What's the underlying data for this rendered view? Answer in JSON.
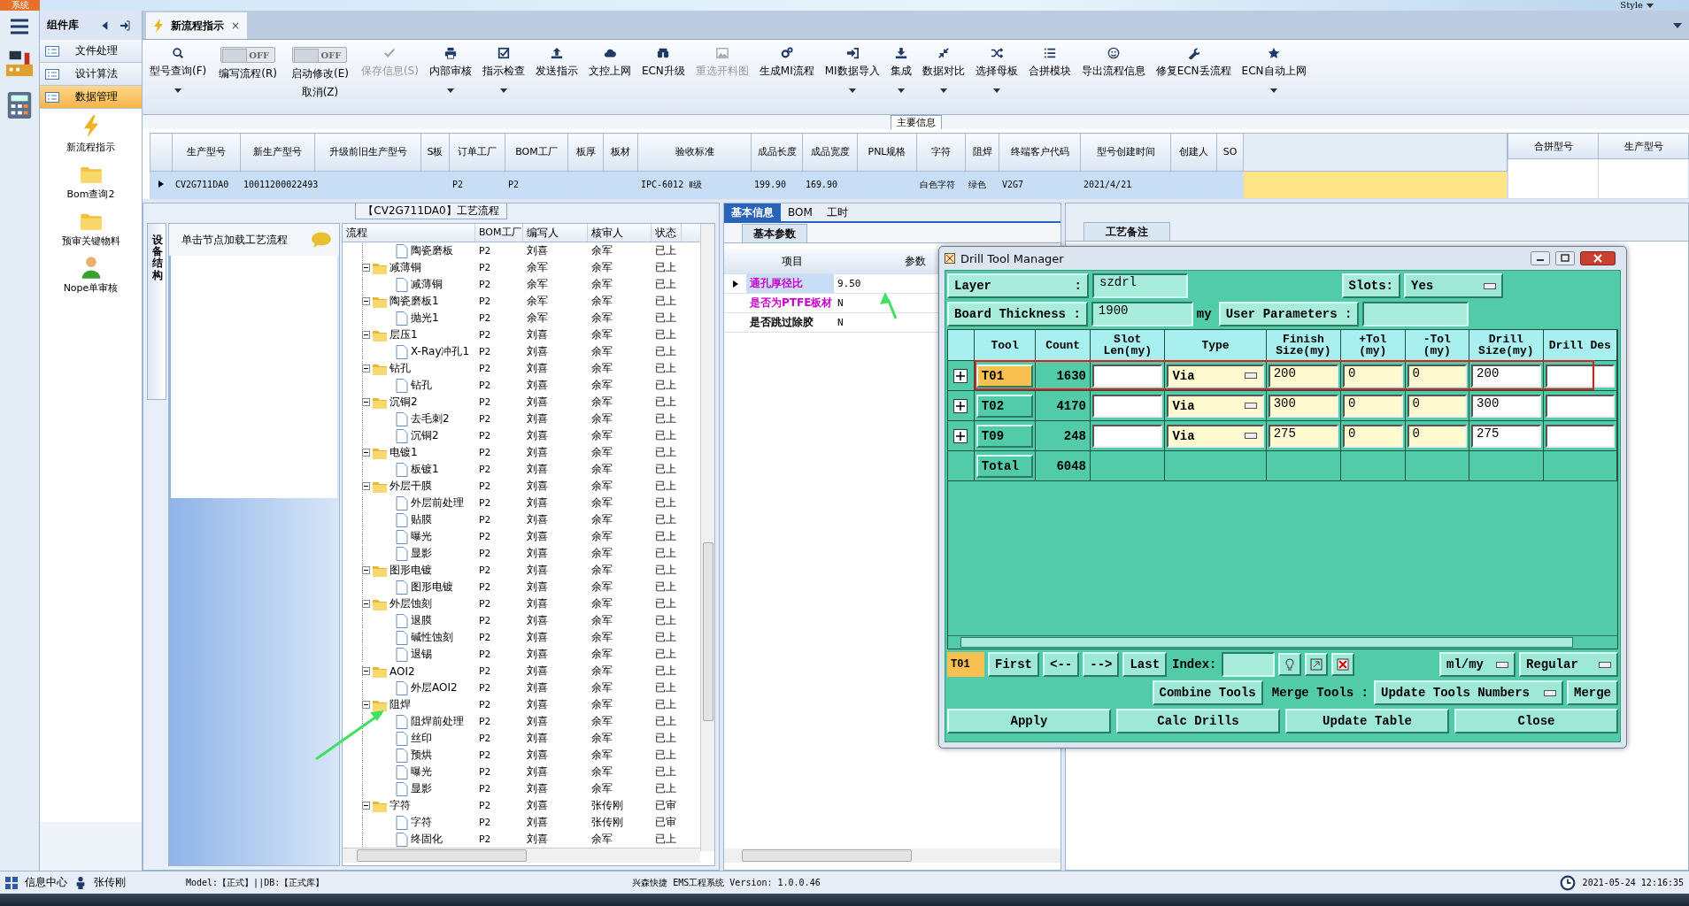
{
  "app_tab": "系统",
  "style_menu": "Style",
  "sidebar": {
    "title": "组件库",
    "nav": [
      {
        "label": "文件处理",
        "selected": false
      },
      {
        "label": "设计算法",
        "selected": false
      },
      {
        "label": "数据管理",
        "selected": true
      }
    ],
    "tiles": [
      "新流程指示",
      "Bom查询2",
      "预审关键物料",
      "Nope单审核"
    ]
  },
  "doc_tab": {
    "label": "新流程指示",
    "close": "×"
  },
  "toolbar": [
    {
      "kind": "button",
      "label": "型号查询(F)",
      "dropdown": true,
      "disabled": false
    },
    {
      "kind": "toggle",
      "label": "编写流程(R)",
      "switch": "OFF",
      "on": false
    },
    {
      "kind": "toggle",
      "label": "启动修改(E)",
      "label2": "取消(Z)",
      "switch": "OFF",
      "on": false
    },
    {
      "kind": "button",
      "label": "保存信息(S)",
      "dropdown": false,
      "disabled": true
    },
    {
      "kind": "button",
      "label": "内部审核",
      "dropdown": true,
      "disabled": false
    },
    {
      "kind": "button",
      "label": "指示检查",
      "dropdown": true,
      "disabled": false
    },
    {
      "kind": "button",
      "label": "发送指示",
      "dropdown": false,
      "disabled": false
    },
    {
      "kind": "button",
      "label": "文控上网",
      "dropdown": false,
      "disabled": false
    },
    {
      "kind": "button",
      "label": "ECN升级",
      "dropdown": false,
      "disabled": false
    },
    {
      "kind": "button",
      "label": "重选开料图",
      "dropdown": false,
      "disabled": true
    },
    {
      "kind": "button",
      "label": "生成MI流程",
      "dropdown": false,
      "disabled": false
    },
    {
      "kind": "button",
      "label": "MI数据导入",
      "dropdown": true,
      "disabled": false
    },
    {
      "kind": "button",
      "label": "集成",
      "dropdown": true,
      "disabled": false
    },
    {
      "kind": "button",
      "label": "数据对比",
      "dropdown": true,
      "disabled": false
    },
    {
      "kind": "button",
      "label": "选择母板",
      "dropdown": true,
      "disabled": false
    },
    {
      "kind": "button",
      "label": "合拼模块",
      "dropdown": false,
      "disabled": false
    },
    {
      "kind": "button",
      "label": "导出流程信息",
      "dropdown": false,
      "disabled": false
    },
    {
      "kind": "button",
      "label": "修复ECN丢流程",
      "dropdown": false,
      "disabled": false
    },
    {
      "kind": "button",
      "label": "ECN自动上网",
      "dropdown": true,
      "disabled": false
    }
  ],
  "main_info": {
    "title": "主要信息",
    "columns": [
      "生产型号",
      "新生产型号",
      "升级前旧生产型号",
      "S板",
      "订单工厂",
      "BOM工厂",
      "板厚",
      "板材",
      "验收标准",
      "成品长度",
      "成品宽度",
      "PNL规格",
      "字符",
      "阻焊",
      "终端客户代码",
      "型号创建时间",
      "创建人",
      "SO"
    ],
    "rows": [
      {
        "selected": true,
        "cells": [
          "CV2G711DA0",
          "10011200022493",
          null,
          null,
          "P2",
          "P2",
          null,
          null,
          "IPC-6012 Ⅱ级",
          "199.90",
          "169.90",
          null,
          "白色字符",
          "绿色",
          "V2G7",
          "2021/4/21",
          null,
          null
        ]
      }
    ]
  },
  "merge_grid": {
    "columns": [
      "合拼型号",
      "生产型号"
    ]
  },
  "process_panel": {
    "title": "【CV2G711DA0】工艺流程",
    "side_tab": "设备结构",
    "hint": "单击节点加载工艺流程",
    "columns": [
      "流程",
      "BOM工厂",
      "编写人",
      "核审人",
      "状态"
    ],
    "tree": [
      {
        "kind": "file",
        "label": "陶瓷磨板",
        "bom": "P2",
        "writer": "刘喜",
        "reviewer": "余军",
        "status": "已上"
      },
      {
        "kind": "folder",
        "label": "减薄铜",
        "bom": "P2",
        "writer": "余军",
        "reviewer": "余军",
        "status": "已上",
        "expanded": true,
        "children": [
          {
            "kind": "file",
            "label": "减薄铜",
            "bom": "P2",
            "writer": "余军",
            "reviewer": "余军",
            "status": "已上"
          }
        ]
      },
      {
        "kind": "folder",
        "label": "陶瓷磨板1",
        "bom": "P2",
        "writer": "余军",
        "reviewer": "余军",
        "status": "已上",
        "expanded": true,
        "children": [
          {
            "kind": "file",
            "label": "抛光1",
            "bom": "P2",
            "writer": "余军",
            "reviewer": "余军",
            "status": "已上"
          }
        ]
      },
      {
        "kind": "folder",
        "label": "层压1",
        "bom": "P2",
        "writer": "刘喜",
        "reviewer": "余军",
        "status": "已上",
        "expanded": true,
        "children": [
          {
            "kind": "file",
            "label": "X-Ray冲孔1",
            "bom": "P2",
            "writer": "刘喜",
            "reviewer": "余军",
            "status": "已上"
          }
        ]
      },
      {
        "kind": "folder",
        "label": "钻孔",
        "bom": "P2",
        "writer": "刘喜",
        "reviewer": "余军",
        "status": "已上",
        "expanded": true,
        "children": [
          {
            "kind": "file",
            "label": "钻孔",
            "bom": "P2",
            "writer": "刘喜",
            "reviewer": "余军",
            "status": "已上"
          }
        ]
      },
      {
        "kind": "folder",
        "label": "沉铜2",
        "bom": "P2",
        "writer": "刘喜",
        "reviewer": "余军",
        "status": "已上",
        "expanded": true,
        "children": [
          {
            "kind": "file",
            "label": "去毛刺2",
            "bom": "P2",
            "writer": "刘喜",
            "reviewer": "余军",
            "status": "已上"
          },
          {
            "kind": "file",
            "label": "沉铜2",
            "bom": "P2",
            "writer": "刘喜",
            "reviewer": "余军",
            "status": "已上"
          }
        ]
      },
      {
        "kind": "folder",
        "label": "电镀1",
        "bom": "P2",
        "writer": "刘喜",
        "reviewer": "余军",
        "status": "已上",
        "expanded": true,
        "children": [
          {
            "kind": "file",
            "label": "板镀1",
            "bom": "P2",
            "writer": "刘喜",
            "reviewer": "余军",
            "status": "已上"
          }
        ]
      },
      {
        "kind": "folder",
        "label": "外层干膜",
        "bom": "P2",
        "writer": "刘喜",
        "reviewer": "余军",
        "status": "已上",
        "expanded": true,
        "children": [
          {
            "kind": "file",
            "label": "外层前处理",
            "bom": "P2",
            "writer": "刘喜",
            "reviewer": "余军",
            "status": "已上"
          },
          {
            "kind": "file",
            "label": "贴膜",
            "bom": "P2",
            "writer": "刘喜",
            "reviewer": "余军",
            "status": "已上"
          },
          {
            "kind": "file",
            "label": "曝光",
            "bom": "P2",
            "writer": "刘喜",
            "reviewer": "余军",
            "status": "已上"
          },
          {
            "kind": "file",
            "label": "显影",
            "bom": "P2",
            "writer": "刘喜",
            "reviewer": "余军",
            "status": "已上"
          }
        ]
      },
      {
        "kind": "folder",
        "label": "图形电镀",
        "bom": "P2",
        "writer": "刘喜",
        "reviewer": "余军",
        "status": "已上",
        "expanded": true,
        "children": [
          {
            "kind": "file",
            "label": "图形电镀",
            "bom": "P2",
            "writer": "刘喜",
            "reviewer": "余军",
            "status": "已上"
          }
        ]
      },
      {
        "kind": "folder",
        "label": "外层蚀刻",
        "bom": "P2",
        "writer": "刘喜",
        "reviewer": "余军",
        "status": "已上",
        "expanded": true,
        "children": [
          {
            "kind": "file",
            "label": "退膜",
            "bom": "P2",
            "writer": "刘喜",
            "reviewer": "余军",
            "status": "已上"
          },
          {
            "kind": "file",
            "label": "碱性蚀刻",
            "bom": "P2",
            "writer": "刘喜",
            "reviewer": "余军",
            "status": "已上"
          },
          {
            "kind": "file",
            "label": "退锡",
            "bom": "P2",
            "writer": "刘喜",
            "reviewer": "余军",
            "status": "已上"
          }
        ]
      },
      {
        "kind": "folder",
        "label": "AOI2",
        "bom": "P2",
        "writer": "刘喜",
        "reviewer": "余军",
        "status": "已上",
        "expanded": true,
        "children": [
          {
            "kind": "file",
            "label": "外层AOI2",
            "bom": "P2",
            "writer": "刘喜",
            "reviewer": "余军",
            "status": "已上"
          }
        ]
      },
      {
        "kind": "folder",
        "label": "阻焊",
        "bom": "P2",
        "writer": "刘喜",
        "reviewer": "余军",
        "status": "已上",
        "expanded": true,
        "children": [
          {
            "kind": "file",
            "label": "阻焊前处理",
            "bom": "P2",
            "writer": "刘喜",
            "reviewer": "余军",
            "status": "已上"
          },
          {
            "kind": "file",
            "label": "丝印",
            "bom": "P2",
            "writer": "刘喜",
            "reviewer": "余军",
            "status": "已上"
          },
          {
            "kind": "file",
            "label": "预烘",
            "bom": "P2",
            "writer": "刘喜",
            "reviewer": "余军",
            "status": "已上"
          },
          {
            "kind": "file",
            "label": "曝光",
            "bom": "P2",
            "writer": "刘喜",
            "reviewer": "余军",
            "status": "已上"
          },
          {
            "kind": "file",
            "label": "显影",
            "bom": "P2",
            "writer": "刘喜",
            "reviewer": "余军",
            "status": "已上"
          }
        ]
      },
      {
        "kind": "folder",
        "label": "字符",
        "bom": "P2",
        "writer": "刘喜",
        "reviewer": "张传刚",
        "status": "已审",
        "expanded": true,
        "children": [
          {
            "kind": "file",
            "label": "字符",
            "bom": "P2",
            "writer": "刘喜",
            "reviewer": "张传刚",
            "status": "已审"
          },
          {
            "kind": "file",
            "label": "终固化",
            "bom": "P2",
            "writer": "刘喜",
            "reviewer": "余军",
            "status": "已上"
          }
        ]
      }
    ]
  },
  "info_panel": {
    "tabs": [
      {
        "label": "基本信息",
        "selected": true
      },
      {
        "label": "BOM",
        "selected": false
      },
      {
        "label": "工时",
        "selected": false
      }
    ],
    "sub_tab": "基本参数",
    "columns": [
      "项目",
      "参数"
    ],
    "rows": [
      {
        "item": "通孔厚径比",
        "value": "9.50",
        "selected": true,
        "color": "#cc00cc"
      },
      {
        "item": "是否为PTFE板材",
        "value": "N",
        "selected": false,
        "color": "#cc00cc"
      },
      {
        "item": "是否跳过除胶",
        "value": "N",
        "selected": false,
        "color": "#000000"
      }
    ]
  },
  "remarks_panel": {
    "tab": "工艺备注"
  },
  "dialog": {
    "title": "Drill Tool Manager",
    "layer_label": "Layer",
    "layer_colon": ":",
    "layer": "szdrl",
    "slots_label": "Slots:",
    "slots": "Yes",
    "thickness_label": "Board Thickness :",
    "thickness": "1900",
    "thickness_unit": "my",
    "user_params": "User Parameters :",
    "columns": [
      "Tool",
      "Count",
      "Slot Len(my)",
      "Type",
      "Finish Size(my)",
      "+Tol (my)",
      "-Tol (my)",
      "Drill Size(my)",
      "Drill Des"
    ],
    "rows": [
      {
        "tool": "T01",
        "count": "1630",
        "type": "Via",
        "finish": "200",
        "plus_tol": "0",
        "minus_tol": "0",
        "drill": "200",
        "selected": true
      },
      {
        "tool": "T02",
        "count": "4170",
        "type": "Via",
        "finish": "300",
        "plus_tol": "0",
        "minus_tol": "0",
        "drill": "300",
        "selected": false
      },
      {
        "tool": "T09",
        "count": "248",
        "type": "Via",
        "finish": "275",
        "plus_tol": "0",
        "minus_tol": "0",
        "drill": "275",
        "selected": false
      }
    ],
    "total_label": "Total",
    "total": "6048",
    "current_tool": "T01",
    "nav": [
      "First",
      "<--",
      "-->",
      "Last"
    ],
    "index_label": "Index:",
    "units": "ml/my",
    "mode": "Regular",
    "combine": "Combine Tools",
    "merge_label": "Merge Tools :",
    "merge_option": "Update Tools Numbers",
    "merge": "Merge",
    "buttons": [
      "Apply",
      "Calc Drills",
      "Update Table",
      "Close"
    ]
  },
  "status_bar": {
    "info_center": "信息中心",
    "user": "张传刚",
    "model": "Model:【正式】||DB:【正式库】",
    "app": "兴森快捷 EMS工程系统 Version: 1.0.0.46",
    "time": "2021-05-24 12:16:35"
  }
}
